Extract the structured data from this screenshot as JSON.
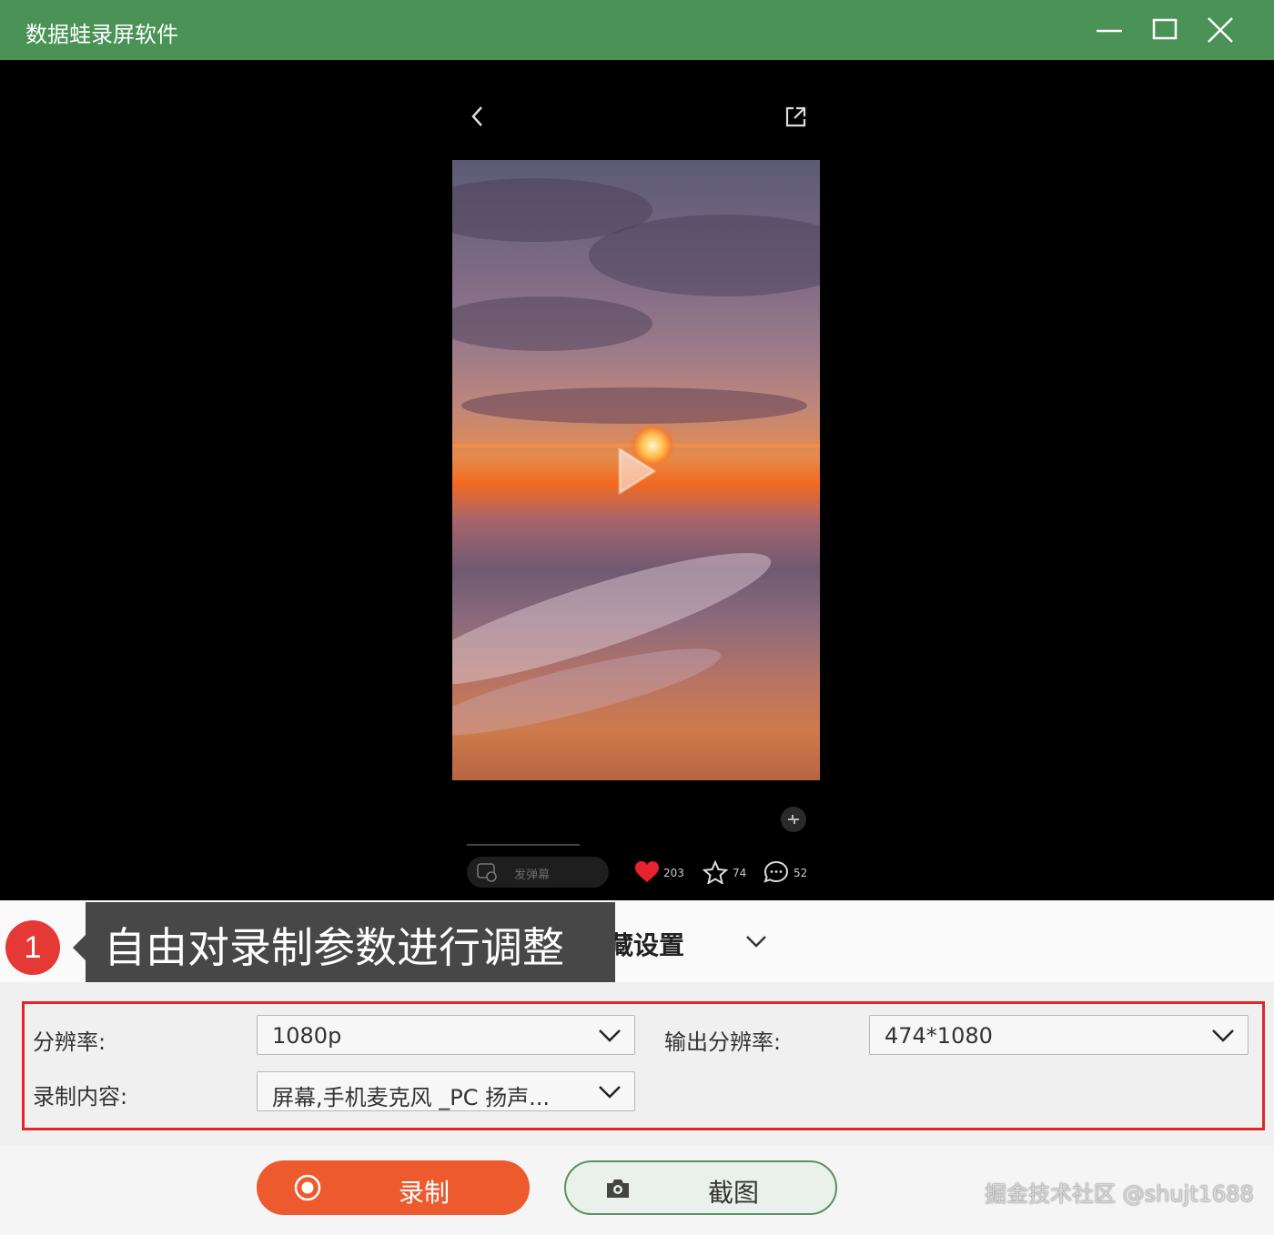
{
  "app": {
    "title": "数据蛙录屏软件"
  },
  "preview": {
    "danmu_placeholder": "发弹幕",
    "likes": "203",
    "stars": "74",
    "comments": "52"
  },
  "annotation": {
    "step_number": "1",
    "tip_text": "自由对录制参数进行调整"
  },
  "settings": {
    "hidden_settings_label": "隐藏设置",
    "resolution_label": "分辨率:",
    "resolution_value": "1080p",
    "output_resolution_label": "输出分辨率:",
    "output_resolution_value": "474*1080",
    "record_content_label": "录制内容:",
    "record_content_value": "屏幕,手机麦克风 _PC 扬声..."
  },
  "actions": {
    "record_label": "录制",
    "screenshot_label": "截图"
  },
  "watermark": "掘金技术社区 @shujt1688",
  "colors": {
    "titlebar": "#4a9256",
    "record_button": "#ec5a2e",
    "highlight_box": "#e0262b",
    "badge": "#e53935",
    "like_heart": "#e8232e"
  }
}
